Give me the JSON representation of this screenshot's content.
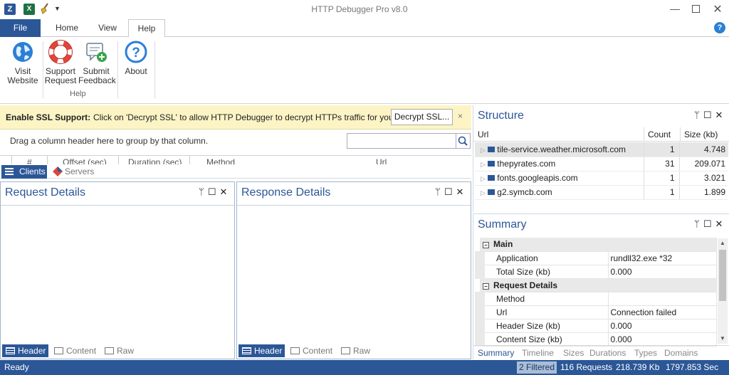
{
  "app_title": "HTTP Debugger Pro v8.0",
  "ribbon_tabs": [
    "File",
    "Home",
    "View",
    "Help"
  ],
  "ribbon": {
    "buttons": [
      {
        "line1": "Visit",
        "line2": "Website"
      },
      {
        "line1": "Support",
        "line2": "Request"
      },
      {
        "line1": "Submit",
        "line2": "Feedback"
      },
      {
        "line1": "About",
        "line2": ""
      }
    ],
    "group_label": "Help"
  },
  "ssl_bar": {
    "title": "Enable SSL Support:",
    "message": "Click on 'Decrypt SSL' to allow HTTP Debugger to decrypt HTTPs traffic for you.",
    "button": "Decrypt SSL...",
    "close": "×"
  },
  "group_bar": {
    "hint": "Drag a column header here to group by that column.",
    "search_value": ""
  },
  "grid_columns": [
    "#",
    "Offset (sec)",
    "Duration (sec)",
    "Method",
    "Url"
  ],
  "client_tabs": [
    "Clients",
    "Servers"
  ],
  "request_panel": {
    "title": "Request Details",
    "tabs": [
      "Header",
      "Content",
      "Raw"
    ]
  },
  "response_panel": {
    "title": "Response Details",
    "tabs": [
      "Header",
      "Content",
      "Raw"
    ]
  },
  "structure": {
    "title": "Structure",
    "columns": [
      "Url",
      "Count",
      "Size (kb)"
    ],
    "rows": [
      {
        "url": "tile-service.weather.microsoft.com",
        "count": "1",
        "size": "4.748"
      },
      {
        "url": "thepyrates.com",
        "count": "31",
        "size": "209.071"
      },
      {
        "url": "fonts.googleapis.com",
        "count": "1",
        "size": "3.021"
      },
      {
        "url": "g2.symcb.com",
        "count": "1",
        "size": "1.899"
      }
    ]
  },
  "summary": {
    "title": "Summary",
    "sections": [
      {
        "name": "Main",
        "rows": [
          {
            "key": "Application",
            "value": "rundll32.exe *32"
          },
          {
            "key": "Total Size (kb)",
            "value": "0.000"
          }
        ]
      },
      {
        "name": "Request Details",
        "rows": [
          {
            "key": "Method",
            "value": ""
          },
          {
            "key": "Url",
            "value": "Connection failed"
          },
          {
            "key": "Header Size (kb)",
            "value": "0.000"
          },
          {
            "key": "Content Size (kb)",
            "value": "0.000"
          }
        ]
      }
    ],
    "tabs": [
      "Summary",
      "Timeline",
      "Sizes",
      "Durations",
      "Types",
      "Domains"
    ]
  },
  "status": {
    "ready": "Ready",
    "filtered": "2 Filtered",
    "requests": "116 Requests",
    "size": "218.739 Kb",
    "duration": "1797.853 Sec"
  },
  "colors": {
    "accent": "#2b5797",
    "ssl_bar": "#fdf4c5",
    "title_blue": "#2b5797"
  }
}
